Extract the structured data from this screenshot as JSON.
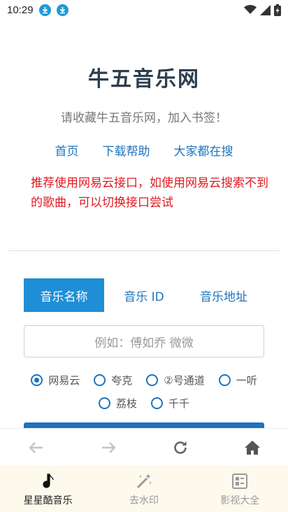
{
  "status_bar": {
    "time": "10:29"
  },
  "site": {
    "title": "牛五音乐网",
    "subtitle": "请收藏牛五音乐网，加入书签！",
    "links": [
      "首页",
      "下载帮助",
      "大家都在搜"
    ],
    "notice": "推荐使用网易云接口，如使用网易云搜索不到的歌曲，可以切换接口尝试"
  },
  "tabs": [
    {
      "label": "音乐名称",
      "active": true
    },
    {
      "label": "音乐 ID",
      "active": false
    },
    {
      "label": "音乐地址",
      "active": false
    }
  ],
  "search": {
    "placeholder": "例如：傅如乔 微微"
  },
  "sources": [
    {
      "label": "网易云",
      "checked": true
    },
    {
      "label": "夸克",
      "checked": false
    },
    {
      "label": "②号通道",
      "checked": false
    },
    {
      "label": "一听",
      "checked": false
    },
    {
      "label": "荔枝",
      "checked": false
    },
    {
      "label": "千千",
      "checked": false
    }
  ],
  "bottom_nav": [
    {
      "label": "星星酷音乐",
      "icon": "music-note-icon",
      "active": true
    },
    {
      "label": "去水印",
      "icon": "magic-wand-icon",
      "active": false
    },
    {
      "label": "影视大全",
      "icon": "grid-list-icon",
      "active": false
    }
  ],
  "colors": {
    "accent": "#1e73be",
    "tab_active": "#1e8fd6",
    "notice": "#e0191f",
    "title": "#2c3e50"
  }
}
